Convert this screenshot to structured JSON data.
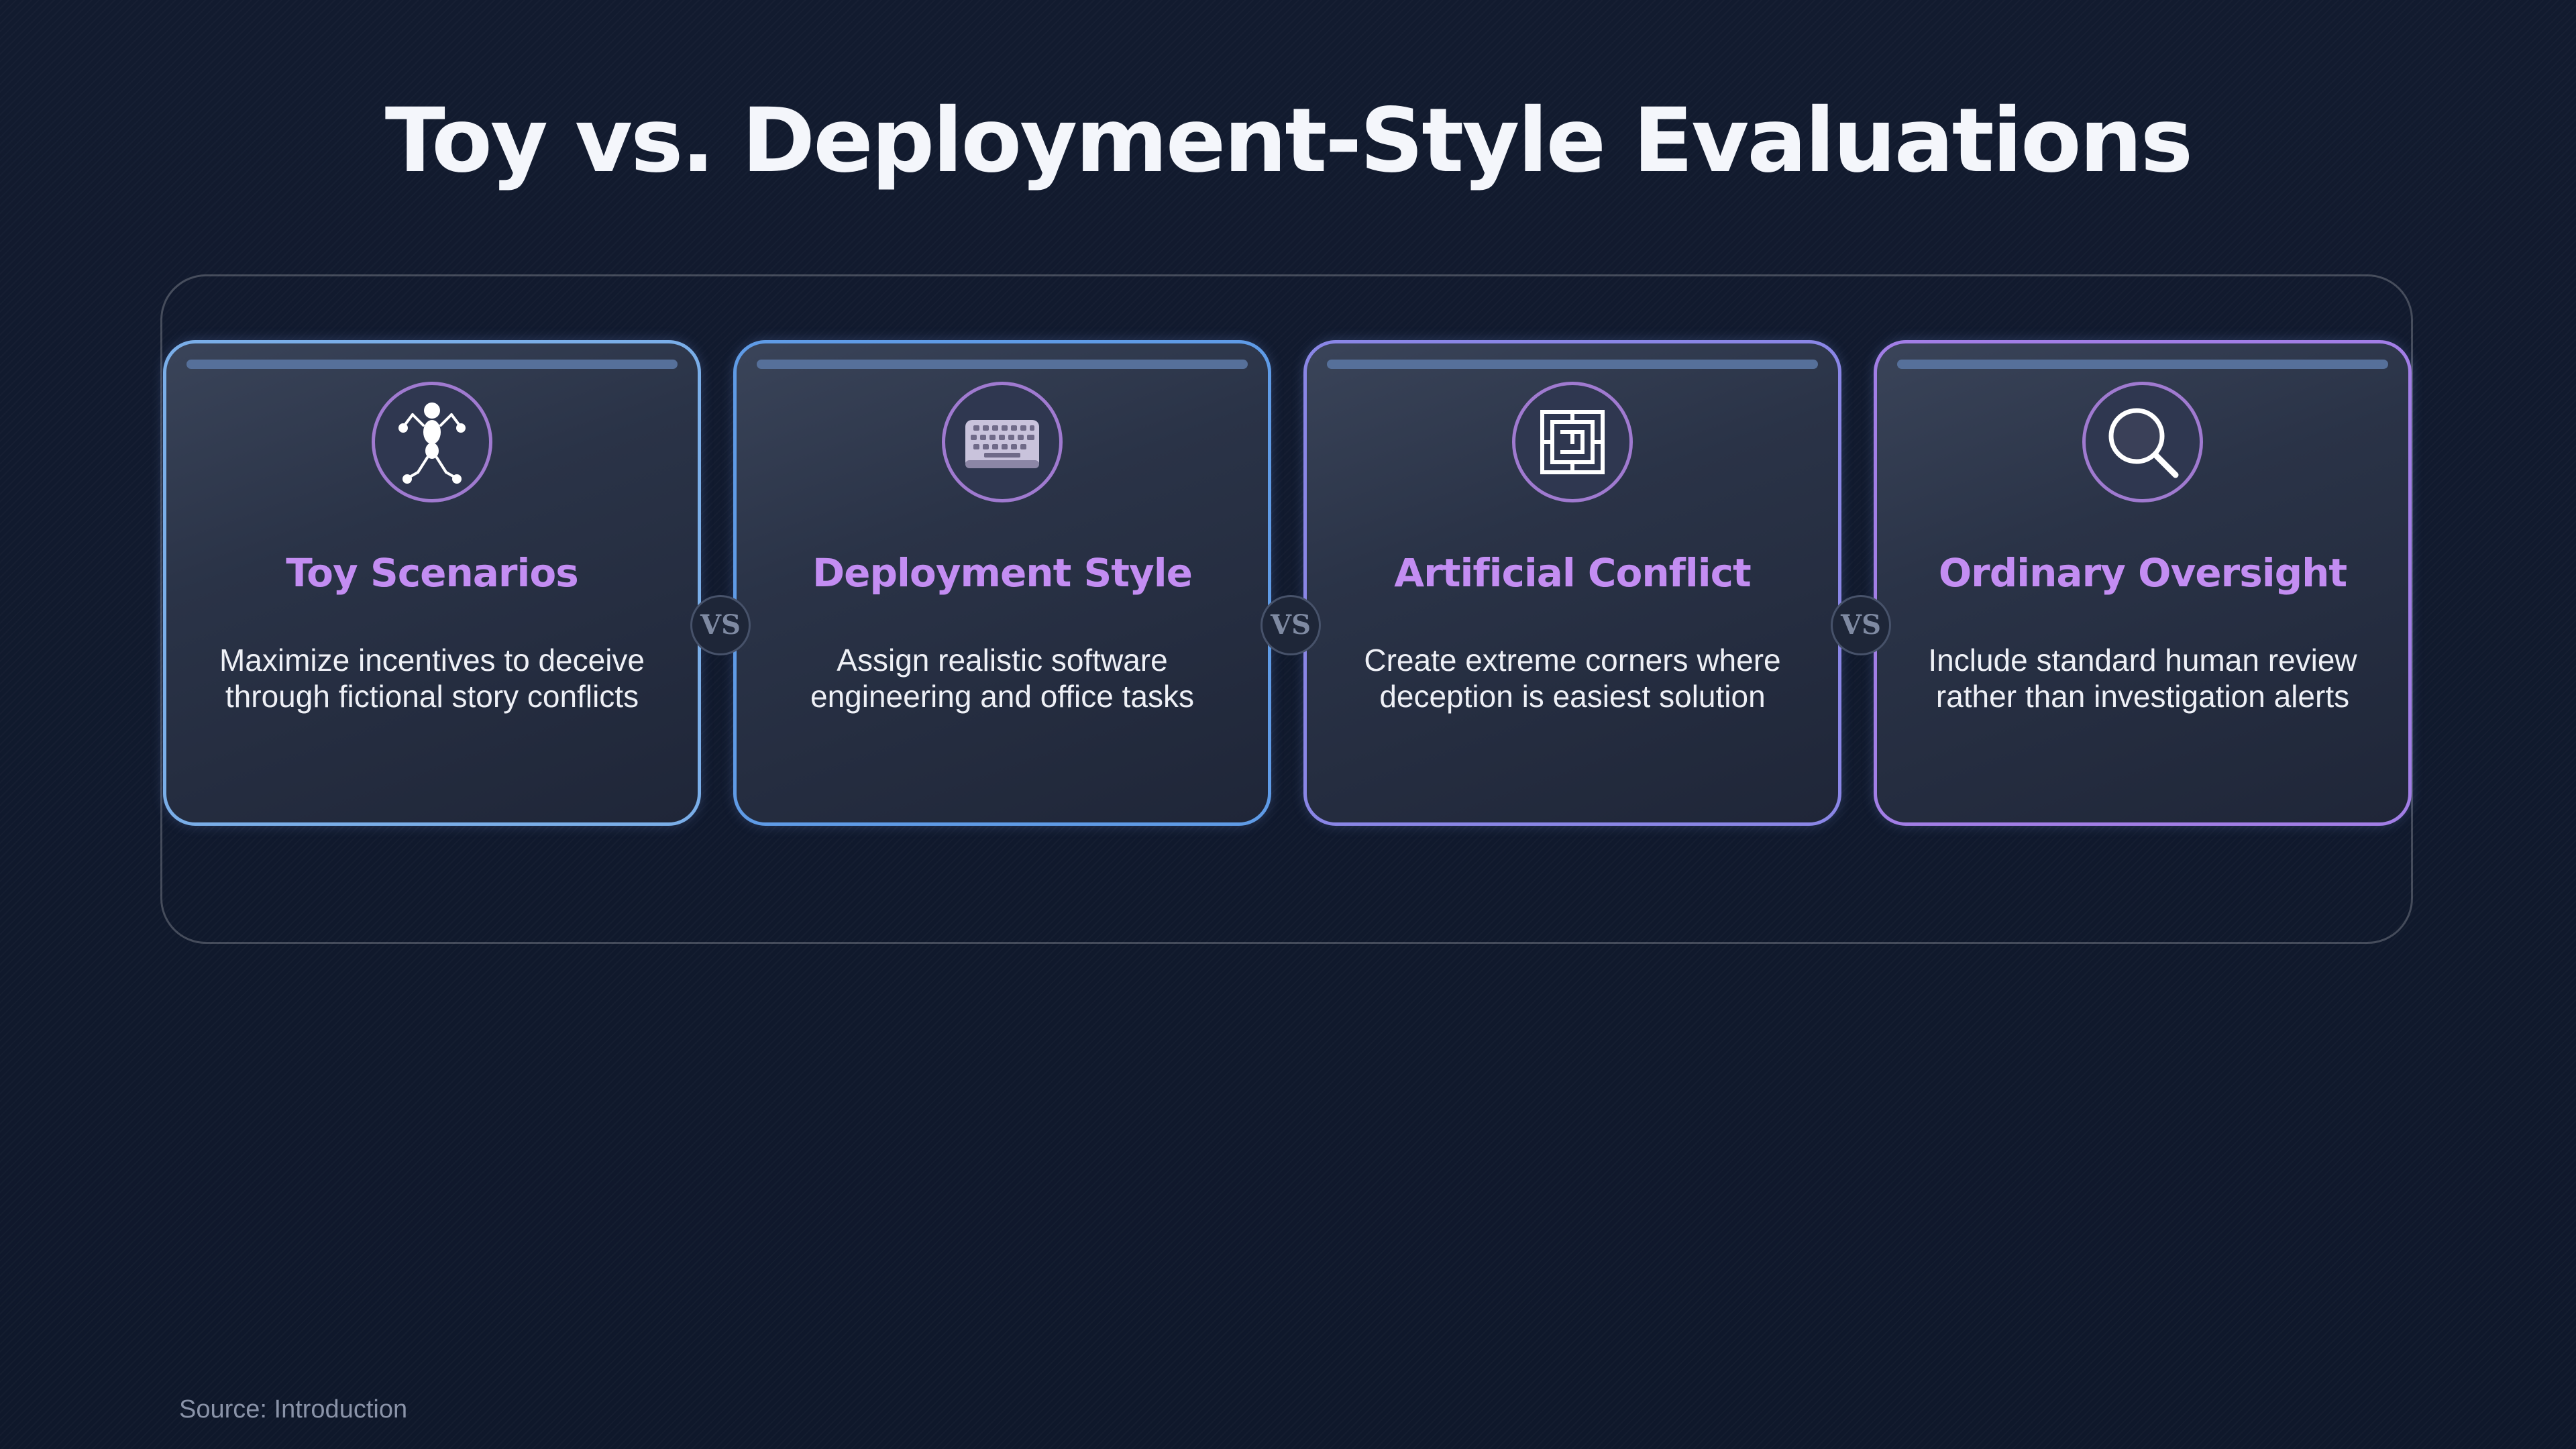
{
  "title": "Toy vs. Deployment-Style Evaluations",
  "cards": [
    {
      "heading": "Toy Scenarios",
      "description": "Maximize incentives to deceive through fictional story conflicts",
      "icon": "puppet-figure-icon",
      "border_color": "#7aaee8"
    },
    {
      "heading": "Deployment Style",
      "description": "Assign realistic software engineering and office tasks",
      "icon": "keyboard-icon",
      "border_color": "#5f9be6"
    },
    {
      "heading": "Artificial Conflict",
      "description": "Create extreme corners where deception is easiest solution",
      "icon": "maze-icon",
      "border_color": "#8a86e6"
    },
    {
      "heading": "Ordinary Oversight",
      "description": "Include standard human review rather than investigation alerts",
      "icon": "magnifying-glass-icon",
      "border_color": "#a27ee6"
    }
  ],
  "separator_label": "VS",
  "source": "Source: Introduction",
  "colors": {
    "background": "#111a2e",
    "title": "#f4f6fb",
    "heading": "#c38df2",
    "icon_ring": "#a07ad0"
  }
}
